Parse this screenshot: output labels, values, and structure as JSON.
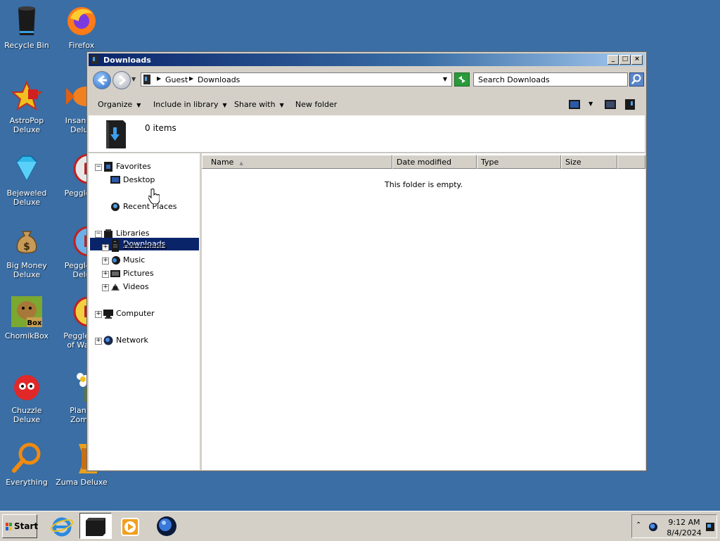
{
  "desktop": {
    "icons": [
      {
        "label": "Recycle Bin",
        "icon": "recycle-bin-icon"
      },
      {
        "label": "Firefox",
        "icon": "firefox-icon"
      },
      {
        "label": "AstroPop Deluxe",
        "icon": "astropop-icon"
      },
      {
        "label": "Insaniquarium Deluxe",
        "icon": "insaniquarium-icon"
      },
      {
        "label": "Bejeweled Deluxe",
        "icon": "bejeweled-icon"
      },
      {
        "label": "Peggle Deluxe",
        "icon": "peggle-icon"
      },
      {
        "label": "Big Money Deluxe",
        "icon": "money-bag-icon"
      },
      {
        "label": "Peggle Nights Deluxe",
        "icon": "peggle-nights-icon"
      },
      {
        "label": "ChomikBox",
        "icon": "chomikbox-icon"
      },
      {
        "label": "Peggle World of Warcraft",
        "icon": "peggle-wow-icon"
      },
      {
        "label": "Chuzzle Deluxe",
        "icon": "chuzzle-icon"
      },
      {
        "label": "Plants vs. Zombies",
        "icon": "plants-zombies-icon"
      },
      {
        "label": "Everything",
        "icon": "everything-search-icon"
      },
      {
        "label": "Zuma Deluxe",
        "icon": "zuma-icon"
      }
    ],
    "visible_labels": {
      "recycle": "Recycle Bin",
      "firefox": "Firefox",
      "astropop_1": "AstroPop",
      "astropop_2": "Deluxe",
      "insaniq_1": "Insaniqu",
      "insaniq_2": "Delux",
      "bejeweled_1": "Bejeweled",
      "bejeweled_2": "Deluxe",
      "peggle_1": "Peggle D",
      "bigmoney_1": "Big Money",
      "bigmoney_2": "Deluxe",
      "peggle_n_1": "Peggle N",
      "peggle_n_2": "Delu",
      "chomik": "ChomikBox",
      "peggle_w_1": "Peggle W",
      "peggle_w_2": "of Warc",
      "chuzzle": "Chuzzle Deluxe",
      "plants_1": "Plants",
      "plants_2": "Zomb",
      "everything": "Everything",
      "zuma": "Zuma Deluxe"
    }
  },
  "window": {
    "title": "Downloads",
    "controls": {
      "minimize": "_",
      "maximize": "□",
      "close": "×"
    },
    "breadcrumb": [
      "Guest",
      "Downloads"
    ],
    "search_placeholder": "Search Downloads",
    "commands": {
      "organize": "Organize",
      "include_in_library": "Include in library",
      "share_with": "Share with",
      "new_folder": "New folder"
    },
    "info": {
      "item_count": "0 items"
    },
    "nav": {
      "favorites": "Favorites",
      "desktop": "Desktop",
      "downloads": "Downloads",
      "recent_places": "Recent Places",
      "libraries": "Libraries",
      "documents": "Documents",
      "music": "Music",
      "pictures": "Pictures",
      "videos": "Videos",
      "computer": "Computer",
      "network": "Network"
    },
    "columns": {
      "name": "Name",
      "date_modified": "Date modified",
      "type": "Type",
      "size": "Size"
    },
    "empty_message": "This folder is empty."
  },
  "taskbar": {
    "start_label": "Start",
    "pinned": [
      "internet-explorer-icon",
      "explorer-icon",
      "media-player-icon",
      "network-globe-icon"
    ],
    "clock": {
      "time": "9:12 AM",
      "date": "8/4/2024"
    }
  },
  "colors": {
    "desktop_bg": "#3a6ea5",
    "title_bar": "#0a246a",
    "selection": "#0a246a"
  }
}
